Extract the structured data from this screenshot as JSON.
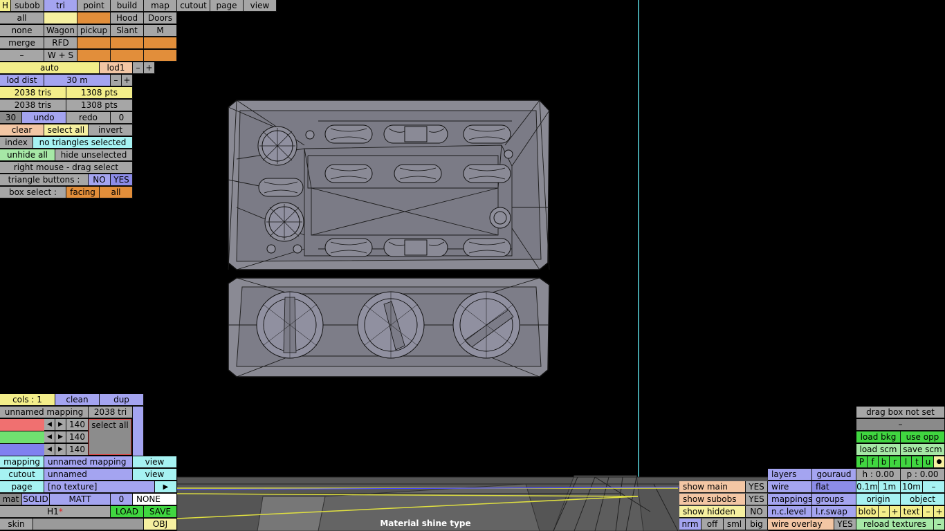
{
  "toolbar": {
    "h": "H",
    "tabs": [
      "subob",
      "tri",
      "point",
      "build",
      "map",
      "cutout",
      "page",
      "view"
    ]
  },
  "subobs": {
    "all": "all",
    "hood": "Hood",
    "doors": "Doors",
    "none": "none",
    "wagon": "Wagon",
    "pickup": "pickup",
    "slant": "Slant",
    "m": "M",
    "merge": "merge",
    "rfd": "RFD",
    "minus": "–",
    "ws": "W + S"
  },
  "lod": {
    "auto": "auto",
    "lod1": "lod1",
    "minus": "–",
    "plus": "+",
    "dist_label": "lod dist",
    "dist_value": "30 m"
  },
  "stats": {
    "tris1": "2038 tris",
    "pts1": "1308 pts",
    "tris2": "2038 tris",
    "pts2": "1308 pts"
  },
  "undo": {
    "count": "30",
    "undo": "undo",
    "redo": "redo",
    "redo_count": "0"
  },
  "selection": {
    "clear": "clear",
    "select_all": "select all",
    "invert": "invert",
    "index": "index",
    "status": "no triangles selected",
    "unhide_all": "unhide all",
    "hide_unselected": "hide unselected",
    "drag_hint": "right mouse - drag select",
    "tri_buttons": "triangle buttons :",
    "no": "NO",
    "yes": "YES",
    "box_select": "box select :",
    "facing": "facing",
    "all": "all"
  },
  "mapping_panel": {
    "cols": "cols : 1",
    "clean": "clean",
    "dup": "dup",
    "mapping_name": "unnamed mapping",
    "tri_count": "2038 tri",
    "rgb": [
      "140",
      "140",
      "140"
    ],
    "select_all": "select all",
    "mapping_label": "mapping",
    "mapping_value": "unnamed mapping",
    "mapping_view": "view",
    "cutout_label": "cutout",
    "cutout_value": "unnamed",
    "cutout_view": "view",
    "page_label": "page",
    "page_value": "[no texture]",
    "page_arrow": "▶",
    "mat": "mat",
    "solid": "SOLID",
    "matt": "MATT",
    "zero": "0",
    "none": "NONE",
    "h1": "H1",
    "star": "*",
    "load": "LOAD",
    "save": "SAVE",
    "skin": "skin",
    "obj": "OBJ"
  },
  "status_bar": {
    "tooltip": "Material shine type"
  },
  "display": {
    "show_main": "show main",
    "show_main_v": "YES",
    "show_subobs": "show subobs",
    "show_subobs_v": "YES",
    "show_hidden": "show hidden",
    "show_hidden_v": "NO",
    "nrm": "nrm",
    "off": "off",
    "sml": "sml",
    "big": "big",
    "wire_overlay": "wire overlay",
    "wire_overlay_v": "YES",
    "layers": "layers",
    "gouraud": "gouraud",
    "wire": "wire",
    "flat": "flat",
    "mappings": "mappings",
    "groups": "groups",
    "nclevel": "n.c.level",
    "lrswap": "l.r.swap"
  },
  "right_panel": {
    "drag_box": "drag box not set",
    "dash": "–",
    "load_bkg": "load bkg",
    "use_opp": "use opp",
    "load_scm": "load scm",
    "save_scm": "save scm",
    "views": [
      "P",
      "f",
      "b",
      "r",
      "l",
      "t",
      "u"
    ],
    "dot": "●",
    "h": "h : 0.00",
    "p": "p : 0.00",
    "steps": [
      "0.1m",
      "1m",
      "10m"
    ],
    "minus": "–",
    "origin": "origin",
    "object": "object",
    "blob": "blob",
    "text": "text",
    "plus": "+",
    "reload": "reload textures"
  },
  "colors": {
    "gray": "#a6a6a6",
    "blue": "#a4a4f0",
    "yellow": "#f6f0a0",
    "orange": "#e28e3a",
    "green": "#40d640",
    "cyan": "#a6f2f2"
  }
}
